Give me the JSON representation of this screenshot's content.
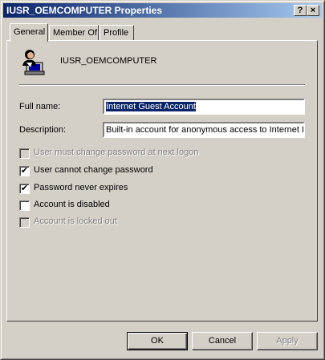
{
  "window": {
    "title": "IUSR_OEMCOMPUTER Properties",
    "help_label": "?",
    "close_label": "×"
  },
  "tabs": [
    {
      "label": "General",
      "active": true
    },
    {
      "label": "Member Of",
      "active": false
    },
    {
      "label": "Profile",
      "active": false
    }
  ],
  "user": {
    "name": "IUSR_OEMCOMPUTER",
    "icon": "user-account-icon"
  },
  "fields": {
    "full_name": {
      "label": "Full name:",
      "value": "Internet Guest Account"
    },
    "description": {
      "label": "Description:",
      "value": "Built-in account for anonymous access to Internet In"
    }
  },
  "checkboxes": [
    {
      "label": "User must change password at next logon",
      "checked": false,
      "enabled": false
    },
    {
      "label": "User cannot change password",
      "checked": true,
      "enabled": true
    },
    {
      "label": "Password never expires",
      "checked": true,
      "enabled": true
    },
    {
      "label": "Account is disabled",
      "checked": false,
      "enabled": true
    },
    {
      "label": "Account is locked out",
      "checked": false,
      "enabled": false
    }
  ],
  "buttons": {
    "ok": "OK",
    "cancel": "Cancel",
    "apply": "Apply"
  }
}
